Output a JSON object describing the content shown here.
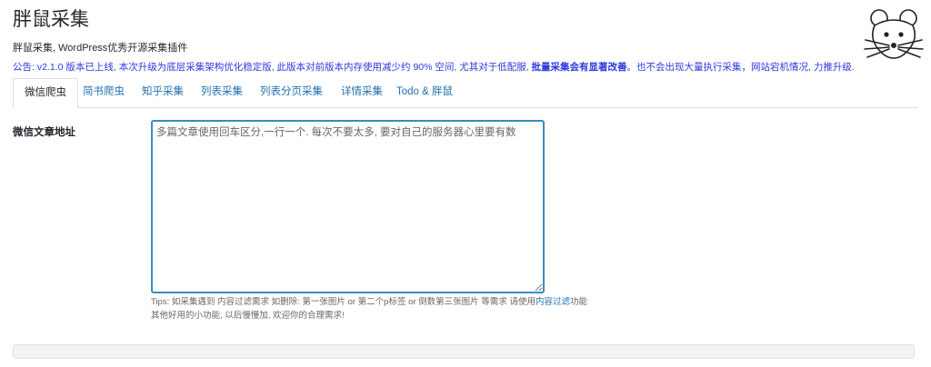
{
  "header": {
    "title": "胖鼠采集",
    "subtitle": "胖鼠采集, WordPress优秀开源采集插件",
    "notice_plain": "公告: v2.1.0 版本已上线, 本次升级为底层采集架构优化稳定版, 此版本对前版本内存使用减少约 90% 空间, 尤其对于低配服, ",
    "notice_bold": "批量采集会有显著改善",
    "notice_tail": "。也不会出现大量执行采集，网站宕机情况, 力推升级."
  },
  "logo": {
    "icon": "mouse-face-icon"
  },
  "tabs": [
    {
      "label": "微信爬虫",
      "active": true
    },
    {
      "label": "简书爬虫"
    },
    {
      "label": "知乎采集"
    },
    {
      "label": "列表采集"
    },
    {
      "label": "列表分页采集"
    },
    {
      "label": "详情采集"
    },
    {
      "label": "Todo & 胖鼠"
    }
  ],
  "form": {
    "label": "微信文章地址",
    "placeholder": "多篇文章使用回车区分,一行一个. 每次不要太多, 要对自己的服务器心里要有数"
  },
  "tips": {
    "line1_prefix": "Tips: 如采集遇到 内容过滤需求 如删除: 第一张图片 or 第二个p标签 or 倒数第三张图片 等需求 请使用",
    "line1_link": "内容过滤",
    "line1_suffix": "功能",
    "line2": "其他好用的小功能, 以后慢慢加, 欢迎你的合理需求!"
  }
}
